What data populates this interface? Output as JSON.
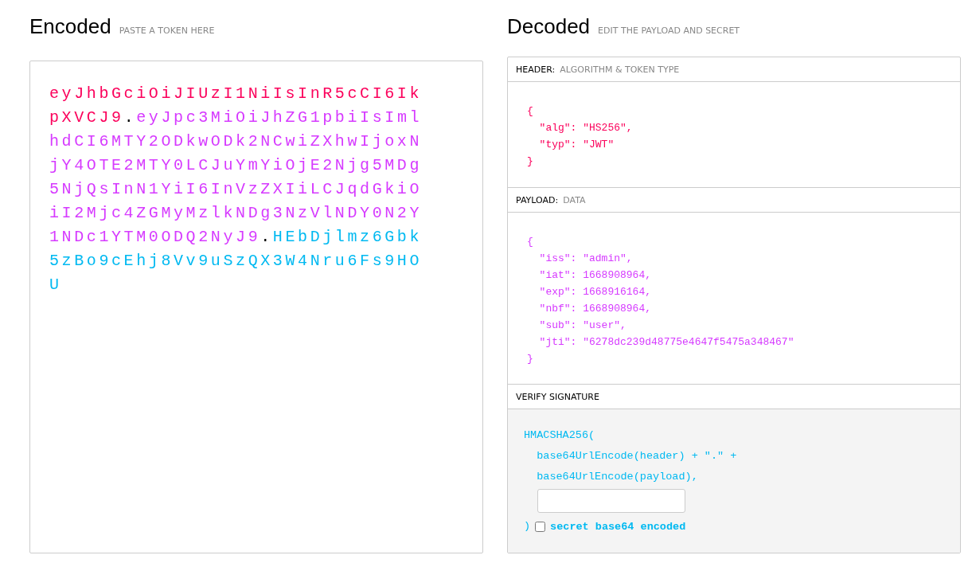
{
  "encoded": {
    "title": "Encoded",
    "hint": "PASTE A TOKEN HERE",
    "token": [
      {
        "kind": "header",
        "text": "eyJhbGciOiJIUzI1NiIsInR5cCI6IkpXVCJ9"
      },
      {
        "kind": "dot",
        "text": "."
      },
      {
        "kind": "payload",
        "text": "eyJpc3MiOiJhZG1pbiIsImlhdCI6MTY2ODkwODk2NCwiZXhwIjoxNjY4OTE2MTY0LCJuYmYiOjE2Njg5MDg5NjQsInN1YiI6InVzZXIiLCJqdGkiOiI2Mjc4ZGMyMzlkNDg3NzVlNDY0N2Y1NDc1YTM0ODQ2NyJ9"
      },
      {
        "kind": "dot",
        "text": "."
      },
      {
        "kind": "signature",
        "text": "HEbDjlmz6Gbk5zBo9cEhj8Vv9uSzQX3W4Nru6Fs9HOU"
      }
    ]
  },
  "decoded": {
    "title": "Decoded",
    "hint": "EDIT THE PAYLOAD AND SECRET",
    "sections": [
      {
        "kind": "header",
        "label": "HEADER:",
        "sublabel": "ALGORITHM & TOKEN TYPE",
        "lines": [
          "{",
          "  \"alg\": \"HS256\",",
          "  \"typ\": \"JWT\"",
          "}"
        ]
      },
      {
        "kind": "payload",
        "label": "PAYLOAD:",
        "sublabel": "DATA",
        "lines": [
          "{",
          "  \"iss\": \"admin\",",
          "  \"iat\": 1668908964,",
          "  \"exp\": 1668916164,",
          "  \"nbf\": 1668908964,",
          "  \"sub\": \"user\",",
          "  \"jti\": \"6278dc239d48775e4647f5475a348467\"",
          "}"
        ]
      },
      {
        "kind": "signature",
        "label": "VERIFY SIGNATURE",
        "lines": [
          "HMACSHA256(",
          "  base64UrlEncode(header) + \".\" +",
          "  base64UrlEncode(payload),"
        ],
        "close": ")",
        "secret_base64": {
          "label": "secret base64 encoded",
          "checked": false
        }
      }
    ]
  }
}
